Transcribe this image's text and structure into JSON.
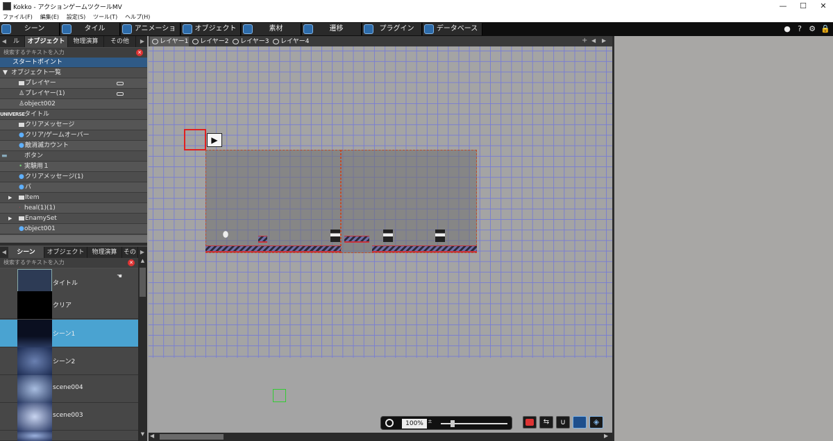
{
  "app": {
    "title": "Kokko - アクションゲームツクールMV",
    "window_controls": [
      "—",
      "☐",
      "✕"
    ]
  },
  "menu": [
    "ファイル(F)",
    "編集(E)",
    "設定(S)",
    "ツール(T)",
    "ヘルプ(H)"
  ],
  "toolbar": {
    "items": [
      "シーン",
      "タイル",
      "アニメーション",
      "オブジェクト",
      "素材",
      "遷移",
      "プラグイン",
      "データベース"
    ],
    "right_icons": [
      "circle-icon",
      "help-icon",
      "gear-icon",
      "lock-icon"
    ]
  },
  "object_panel": {
    "tabs": [
      "ル",
      "オブジェクト",
      "物理演算",
      "その他"
    ],
    "search_placeholder": "検索するテキストを入力",
    "items": [
      {
        "label": "スタートポイント",
        "selected": true
      },
      {
        "label": "オブジェクト一覧"
      },
      {
        "label": "プレイヤー"
      },
      {
        "label": "プレイヤー(1)"
      },
      {
        "label": "object002"
      },
      {
        "label": "タイトル"
      },
      {
        "label": "クリアメッセージ"
      },
      {
        "label": "クリア/ゲームオーバー"
      },
      {
        "label": "敵消滅カウント"
      },
      {
        "label": "ボタン"
      },
      {
        "label": "実験用１"
      },
      {
        "label": "クリアメッセージ(1)"
      },
      {
        "label": "バ"
      },
      {
        "label": "Item"
      },
      {
        "label": "heal(1)(1)"
      },
      {
        "label": "EnamySet"
      },
      {
        "label": "object001"
      }
    ],
    "logo_text": "UNIVERSE"
  },
  "scene_panel": {
    "tabs": [
      "シーン",
      "オブジェクト",
      "物理演算",
      "その"
    ],
    "search_placeholder": "検索するテキストを入力",
    "scenes": [
      {
        "label": "タイトル",
        "selected": false
      },
      {
        "label": "クリア",
        "selected": false
      },
      {
        "label": "シーン1",
        "selected": true
      },
      {
        "label": "シーン2",
        "selected": false
      },
      {
        "label": "scene004",
        "selected": false
      },
      {
        "label": "scene003",
        "selected": false
      }
    ]
  },
  "layers": {
    "tabs": [
      "レイヤー1",
      "レイヤー2",
      "レイヤー3",
      "レイヤー4"
    ],
    "active": "レイヤー1"
  },
  "zoom": {
    "value": "100%"
  },
  "bottom_icons": [
    "paint-icon",
    "link-icon",
    "magnet-icon",
    "grid-icon",
    "shield-icon"
  ],
  "colors": {
    "toolbar_bg": "#0e0e0e",
    "panel_bg": "#4a4a4a",
    "selection": "#2f5a86",
    "scene_selection": "#4aa3d1",
    "grid_line": "#7a7fd0",
    "room_border": "#c04a2a"
  }
}
